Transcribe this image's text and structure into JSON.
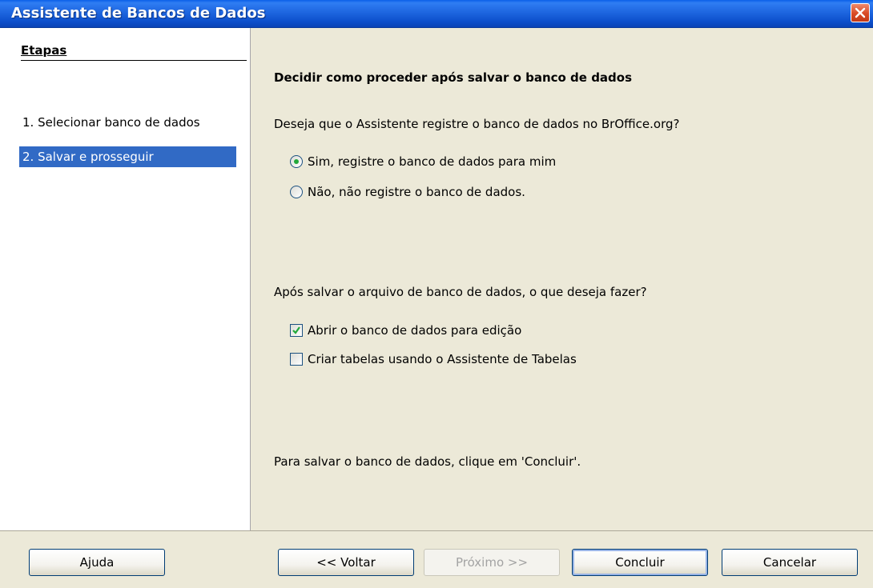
{
  "window": {
    "title": "Assistente de Bancos de Dados"
  },
  "steps": {
    "title": "Etapas",
    "items": [
      {
        "label": "1. Selecionar banco de dados",
        "active": false
      },
      {
        "label": "2. Salvar e prosseguir",
        "active": true
      }
    ]
  },
  "main": {
    "heading": "Decidir como proceder após salvar o banco de dados",
    "register_question": "Deseja que o Assistente registre o banco de dados no BrOffice.org?",
    "register_options": [
      {
        "label": "Sim, registre o banco de dados para mim",
        "selected": true
      },
      {
        "label": "Não, não registre o banco de dados.",
        "selected": false
      }
    ],
    "after_question": "Após salvar o arquivo de banco de dados, o que deseja fazer?",
    "after_options": [
      {
        "label": "Abrir o banco de dados para edição",
        "checked": true
      },
      {
        "label": "Criar tabelas usando o Assistente de Tabelas",
        "checked": false
      }
    ],
    "hint": "Para salvar o banco de dados, clique em 'Concluir'."
  },
  "buttons": {
    "help": "Ajuda",
    "back": "<< Voltar",
    "next": "Próximo >>",
    "finish": "Concluir",
    "cancel": "Cancelar"
  }
}
